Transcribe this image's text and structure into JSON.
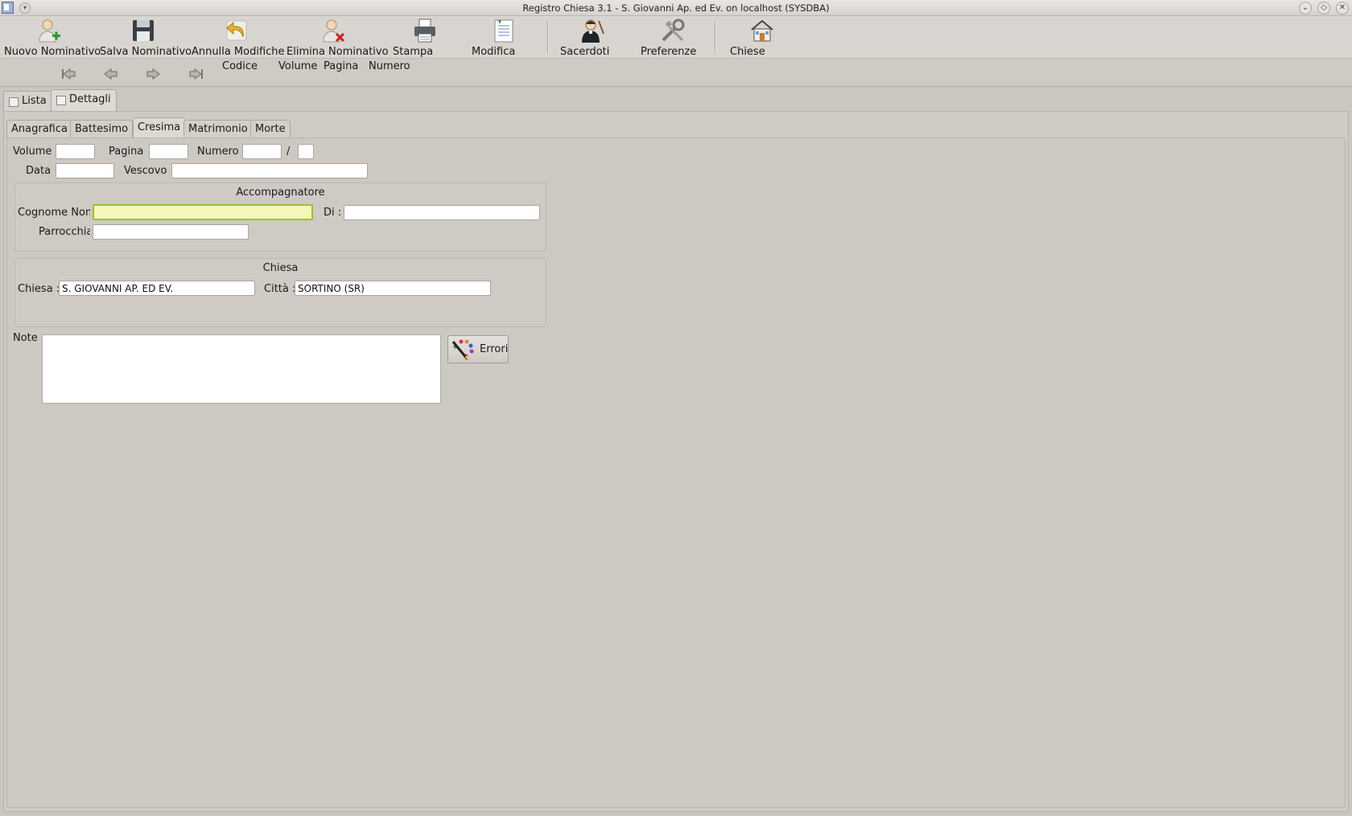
{
  "window": {
    "title": "Registro Chiesa 3.1 - S. Giovanni Ap. ed Ev. on localhost (SYSDBA)"
  },
  "toolbar": {
    "items": [
      {
        "label": "Nuovo Nominativo",
        "icon": "add-person-icon"
      },
      {
        "label": "Salva Nominativo",
        "icon": "floppy-disk-icon"
      },
      {
        "label": "Annulla Modifiche",
        "icon": "undo-icon"
      },
      {
        "label": "Elimina Nominativo",
        "icon": "delete-person-icon"
      },
      {
        "label": "Stampa",
        "icon": "printer-icon"
      },
      {
        "label": "Modifica",
        "icon": "edit-document-icon"
      },
      {
        "label": "Sacerdoti",
        "icon": "priest-icon"
      },
      {
        "label": "Preferenze",
        "icon": "tools-icon"
      },
      {
        "label": "Chiese",
        "icon": "church-icon"
      }
    ]
  },
  "navbar": {
    "labels": [
      "Codice",
      "Volume",
      "Pagina",
      "Numero"
    ]
  },
  "outer_tabs": [
    {
      "label": "Lista",
      "active": false
    },
    {
      "label": "Dettagli",
      "active": true
    }
  ],
  "inner_tabs": [
    {
      "label": "Anagrafica",
      "active": false
    },
    {
      "label": "Battesimo",
      "active": false
    },
    {
      "label": "Cresima",
      "active": true
    },
    {
      "label": "Matrimonio",
      "active": false
    },
    {
      "label": "Morte",
      "active": false
    }
  ],
  "form": {
    "volume_label": "Volume",
    "volume_value": "",
    "pagina_label": "Pagina",
    "pagina_value": "",
    "numero_label": "Numero",
    "numero_value": "",
    "slash": "/",
    "numero_suffix_value": "",
    "data_label": "Data",
    "data_value": "",
    "vescovo_label": "Vescovo",
    "vescovo_value": ""
  },
  "accompagnatore": {
    "title": "Accompagnatore",
    "cognome_label": "Cognome Nom",
    "cognome_value": "",
    "di_label": "Di :",
    "di_value": "",
    "parrocchia_label": "Parrocchia",
    "parrocchia_value": ""
  },
  "chiesa": {
    "title": "Chiesa",
    "chiesa_label": "Chiesa :",
    "chiesa_value": "S. GIOVANNI AP. ED EV.",
    "citta_label": "Città :",
    "citta_value": "SORTINO (SR)"
  },
  "notes": {
    "label": "Note :",
    "value": ""
  },
  "errori_button": {
    "label": "Errori",
    "icon": "palette-brush-icon"
  },
  "colors": {
    "focus_field": "#f4f7b8",
    "focus_border": "#9bc22c",
    "background": "#cbc6c0"
  }
}
